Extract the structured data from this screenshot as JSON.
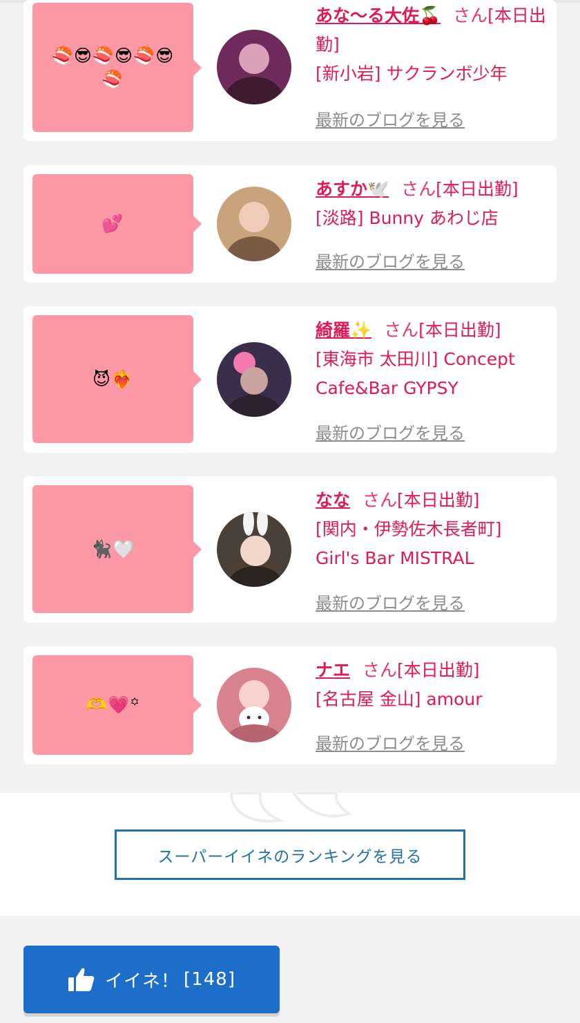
{
  "blog_cards": [
    {
      "bubble_text": "🍣😎🍣😎🍣😎🍣",
      "name": "あな〜る大佐🍒",
      "honorific": "さん",
      "status": "[本日出勤]",
      "shop": "[新小岩] サクランボ少年",
      "blog_link": "最新のブログを見る",
      "avatar_color": "#6d2a5a"
    },
    {
      "bubble_text": "💕",
      "name": "あすか🕊️",
      "honorific": "さん",
      "status": "[本日出勤]",
      "shop": "[淡路] Bunny あわじ店",
      "blog_link": "最新のブログを見る",
      "avatar_color": "#c9a37c"
    },
    {
      "bubble_text": "😈❤️‍🔥",
      "name": "綺羅✨",
      "honorific": "さん",
      "status": "[本日出勤]",
      "shop": "[東海市 太田川] Concept Cafe&Bar GYPSY",
      "blog_link": "最新のブログを見る",
      "avatar_color": "#3a2f4a"
    },
    {
      "bubble_text": "🐈‍⬛🤍",
      "name": "なな",
      "honorific": "さん",
      "status": "[本日出勤]",
      "shop": "[関内・伊勢佐木長者町] Girl's Bar MISTRAL",
      "blog_link": "最新のブログを見る",
      "avatar_color": "#4a4038"
    },
    {
      "bubble_text": "🫶💗꙳",
      "name": "ナエ",
      "honorific": "さん",
      "status": "[本日出勤]",
      "shop": "[名古屋 金山] amour",
      "blog_link": "最新のブログを見る",
      "avatar_color": "#d9838f"
    }
  ],
  "ranking_button_label": "スーパーイイネのランキングを見る",
  "like_button": {
    "label": "イイネ！",
    "count": "[148]",
    "icon": "thumbs-up-icon"
  },
  "colors": {
    "accent_pink": "#e01a56",
    "bubble_pink": "#fd98a6",
    "link_blue": "#2171a8",
    "like_blue": "#1c6ec9"
  }
}
